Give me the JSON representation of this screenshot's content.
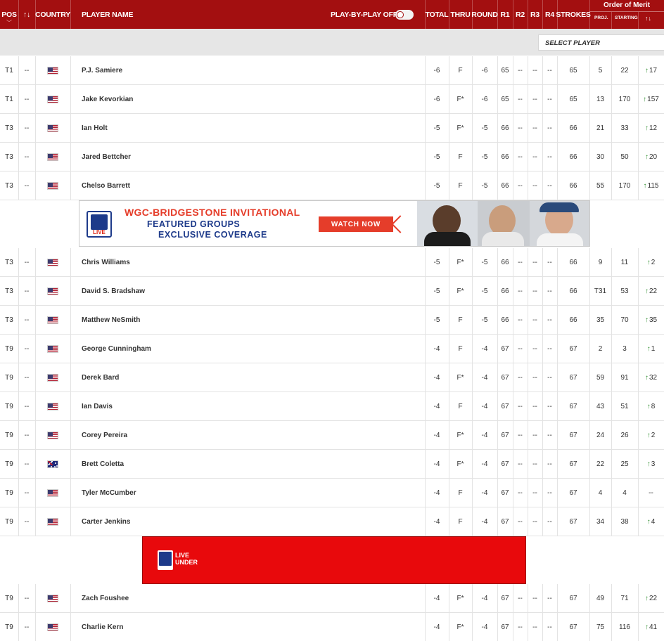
{
  "header": {
    "pos": "POS",
    "move": "↑↓",
    "country": "COUNTRY",
    "player_name": "PLAYER NAME",
    "play_by_play": "PLAY-BY-PLAY OFF",
    "total": "TOTAL",
    "thru": "THRU",
    "round": "ROUND",
    "r1": "R1",
    "r2": "R2",
    "r3": "R3",
    "r4": "R4",
    "strokes": "STROKES",
    "order_of_merit": "Order of Merit",
    "proj": "PROJ.",
    "starting": "STARTING",
    "oom_move": "↑↓"
  },
  "select_player": {
    "placeholder": "SELECT PLAYER"
  },
  "ad_bridgestone": {
    "line1": "WGC-BRIDGESTONE INVITATIONAL",
    "line2": "FEATURED GROUPS",
    "line3": "EXCLUSIVE COVERAGE",
    "cta": "WATCH NOW",
    "logo_text": "LIVE"
  },
  "ad_live_under": {
    "line1": "LIVE",
    "line2": "UNDER"
  },
  "colors": {
    "header_bg": "#a30f10",
    "up_arrow": "#2f8f2f",
    "ad_red": "#e8090c"
  },
  "rows": [
    {
      "pos": "T1",
      "mv": "--",
      "flag": "us",
      "name": "P.J. Samiere",
      "total": "-6",
      "thru": "F",
      "round": "-6",
      "r1": "65",
      "r2": "--",
      "r3": "--",
      "r4": "--",
      "strokes": "65",
      "proj": "5",
      "starting": "22",
      "oom_arrow": "↑",
      "oom_move": "17"
    },
    {
      "pos": "T1",
      "mv": "--",
      "flag": "us",
      "name": "Jake Kevorkian",
      "total": "-6",
      "thru": "F*",
      "round": "-6",
      "r1": "65",
      "r2": "--",
      "r3": "--",
      "r4": "--",
      "strokes": "65",
      "proj": "13",
      "starting": "170",
      "oom_arrow": "↑",
      "oom_move": "157"
    },
    {
      "pos": "T3",
      "mv": "--",
      "flag": "us",
      "name": "Ian Holt",
      "total": "-5",
      "thru": "F*",
      "round": "-5",
      "r1": "66",
      "r2": "--",
      "r3": "--",
      "r4": "--",
      "strokes": "66",
      "proj": "21",
      "starting": "33",
      "oom_arrow": "↑",
      "oom_move": "12"
    },
    {
      "pos": "T3",
      "mv": "--",
      "flag": "us",
      "name": "Jared Bettcher",
      "total": "-5",
      "thru": "F",
      "round": "-5",
      "r1": "66",
      "r2": "--",
      "r3": "--",
      "r4": "--",
      "strokes": "66",
      "proj": "30",
      "starting": "50",
      "oom_arrow": "↑",
      "oom_move": "20"
    },
    {
      "pos": "T3",
      "mv": "--",
      "flag": "us",
      "name": "Chelso Barrett",
      "total": "-5",
      "thru": "F",
      "round": "-5",
      "r1": "66",
      "r2": "--",
      "r3": "--",
      "r4": "--",
      "strokes": "66",
      "proj": "55",
      "starting": "170",
      "oom_arrow": "↑",
      "oom_move": "115"
    },
    {
      "pos": "T3",
      "mv": "--",
      "flag": "us",
      "name": "Chris Williams",
      "total": "-5",
      "thru": "F*",
      "round": "-5",
      "r1": "66",
      "r2": "--",
      "r3": "--",
      "r4": "--",
      "strokes": "66",
      "proj": "9",
      "starting": "11",
      "oom_arrow": "↑",
      "oom_move": "2"
    },
    {
      "pos": "T3",
      "mv": "--",
      "flag": "us",
      "name": "David S. Bradshaw",
      "total": "-5",
      "thru": "F*",
      "round": "-5",
      "r1": "66",
      "r2": "--",
      "r3": "--",
      "r4": "--",
      "strokes": "66",
      "proj": "T31",
      "starting": "53",
      "oom_arrow": "↑",
      "oom_move": "22"
    },
    {
      "pos": "T3",
      "mv": "--",
      "flag": "us",
      "name": "Matthew NeSmith",
      "total": "-5",
      "thru": "F",
      "round": "-5",
      "r1": "66",
      "r2": "--",
      "r3": "--",
      "r4": "--",
      "strokes": "66",
      "proj": "35",
      "starting": "70",
      "oom_arrow": "↑",
      "oom_move": "35"
    },
    {
      "pos": "T9",
      "mv": "--",
      "flag": "us",
      "name": "George Cunningham",
      "total": "-4",
      "thru": "F",
      "round": "-4",
      "r1": "67",
      "r2": "--",
      "r3": "--",
      "r4": "--",
      "strokes": "67",
      "proj": "2",
      "starting": "3",
      "oom_arrow": "↑",
      "oom_move": "1"
    },
    {
      "pos": "T9",
      "mv": "--",
      "flag": "us",
      "name": "Derek Bard",
      "total": "-4",
      "thru": "F*",
      "round": "-4",
      "r1": "67",
      "r2": "--",
      "r3": "--",
      "r4": "--",
      "strokes": "67",
      "proj": "59",
      "starting": "91",
      "oom_arrow": "↑",
      "oom_move": "32"
    },
    {
      "pos": "T9",
      "mv": "--",
      "flag": "us",
      "name": "Ian Davis",
      "total": "-4",
      "thru": "F",
      "round": "-4",
      "r1": "67",
      "r2": "--",
      "r3": "--",
      "r4": "--",
      "strokes": "67",
      "proj": "43",
      "starting": "51",
      "oom_arrow": "↑",
      "oom_move": "8"
    },
    {
      "pos": "T9",
      "mv": "--",
      "flag": "us",
      "name": "Corey Pereira",
      "total": "-4",
      "thru": "F*",
      "round": "-4",
      "r1": "67",
      "r2": "--",
      "r3": "--",
      "r4": "--",
      "strokes": "67",
      "proj": "24",
      "starting": "26",
      "oom_arrow": "↑",
      "oom_move": "2"
    },
    {
      "pos": "T9",
      "mv": "--",
      "flag": "au",
      "name": "Brett Coletta",
      "total": "-4",
      "thru": "F*",
      "round": "-4",
      "r1": "67",
      "r2": "--",
      "r3": "--",
      "r4": "--",
      "strokes": "67",
      "proj": "22",
      "starting": "25",
      "oom_arrow": "↑",
      "oom_move": "3"
    },
    {
      "pos": "T9",
      "mv": "--",
      "flag": "us",
      "name": "Tyler McCumber",
      "total": "-4",
      "thru": "F",
      "round": "-4",
      "r1": "67",
      "r2": "--",
      "r3": "--",
      "r4": "--",
      "strokes": "67",
      "proj": "4",
      "starting": "4",
      "oom_arrow": "",
      "oom_move": "--"
    },
    {
      "pos": "T9",
      "mv": "--",
      "flag": "us",
      "name": "Carter Jenkins",
      "total": "-4",
      "thru": "F",
      "round": "-4",
      "r1": "67",
      "r2": "--",
      "r3": "--",
      "r4": "--",
      "strokes": "67",
      "proj": "34",
      "starting": "38",
      "oom_arrow": "↑",
      "oom_move": "4"
    },
    {
      "pos": "T9",
      "mv": "--",
      "flag": "us",
      "name": "Zach Foushee",
      "total": "-4",
      "thru": "F*",
      "round": "-4",
      "r1": "67",
      "r2": "--",
      "r3": "--",
      "r4": "--",
      "strokes": "67",
      "proj": "49",
      "starting": "71",
      "oom_arrow": "↑",
      "oom_move": "22"
    },
    {
      "pos": "T9",
      "mv": "--",
      "flag": "us",
      "name": "Charlie Kern",
      "total": "-4",
      "thru": "F*",
      "round": "-4",
      "r1": "67",
      "r2": "--",
      "r3": "--",
      "r4": "--",
      "strokes": "67",
      "proj": "75",
      "starting": "116",
      "oom_arrow": "↑",
      "oom_move": "41"
    }
  ]
}
